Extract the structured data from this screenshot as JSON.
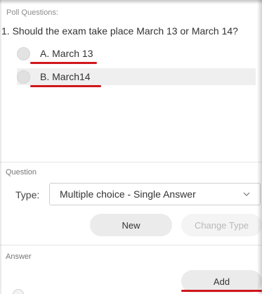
{
  "poll": {
    "header": "Poll Questions:",
    "question": "1. Should the exam take place March 13 or March 14?",
    "options": [
      {
        "label": "A.  March 13",
        "selected": false
      },
      {
        "label": "B.  March14",
        "selected": false
      }
    ]
  },
  "question_section": {
    "label": "Question",
    "type_label": "Type:",
    "type_value": "Multiple choice - Single Answer",
    "chevron_icon": "chevron-down-icon",
    "new_button": "New",
    "change_type_button": "Change Type"
  },
  "answer_section": {
    "label": "Answer",
    "add_button": "Add"
  },
  "colors": {
    "annotation_red": "#d1171c",
    "selected_row_bg": "#efefef",
    "button_bg": "#ebebeb",
    "disabled_text": "#b9b9b9"
  }
}
